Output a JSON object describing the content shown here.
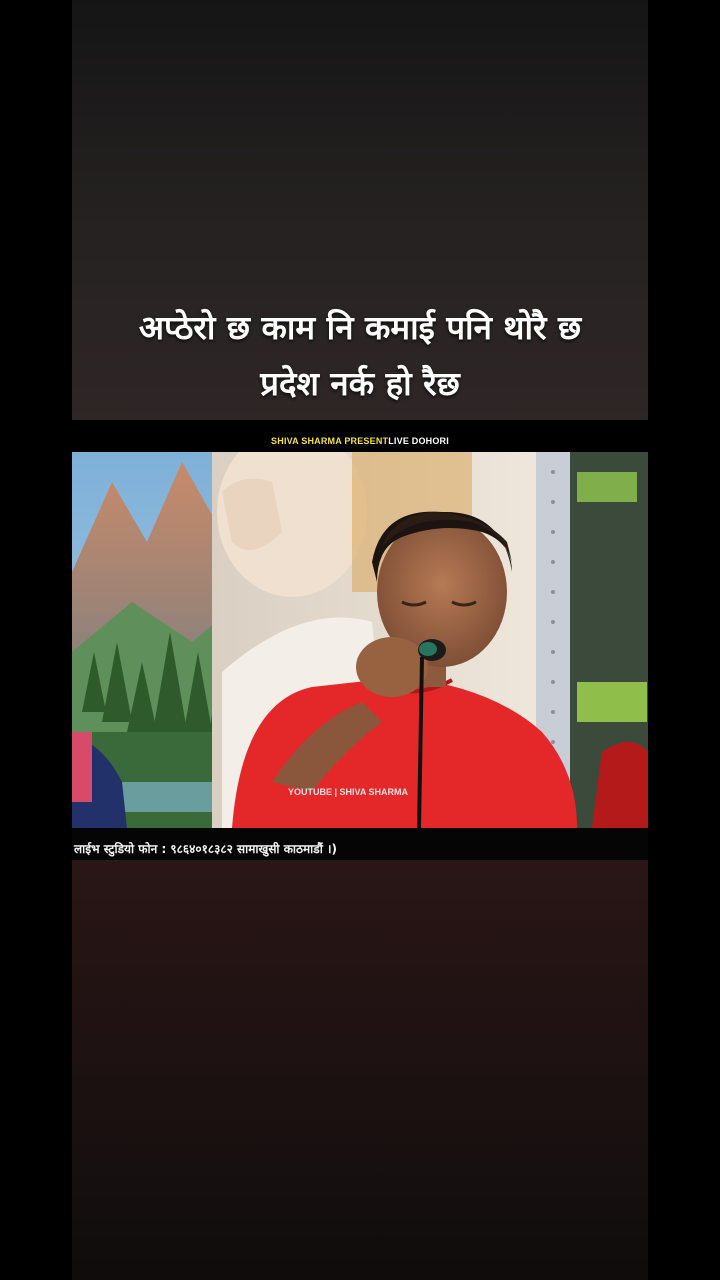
{
  "caption": {
    "line1": "अप्ठेरो छ काम नि कमाई पनि थोरै छ",
    "line2": "प्रदेश नर्क हो रैछ"
  },
  "banner": {
    "presenter": "SHIVA SHARMA PRESENT",
    "show": "LIVE DOHORI"
  },
  "video": {
    "watermark": "YOUTUBE | SHIVA SHARMA"
  },
  "ticker": {
    "text": "लाईभ स्टुडियो फोन : ९८६४०१८३८२ सामाखुसी काठमाडौं ।)"
  },
  "colors": {
    "banner_highlight": "#f4e13a",
    "shirt": "#e4282a"
  }
}
